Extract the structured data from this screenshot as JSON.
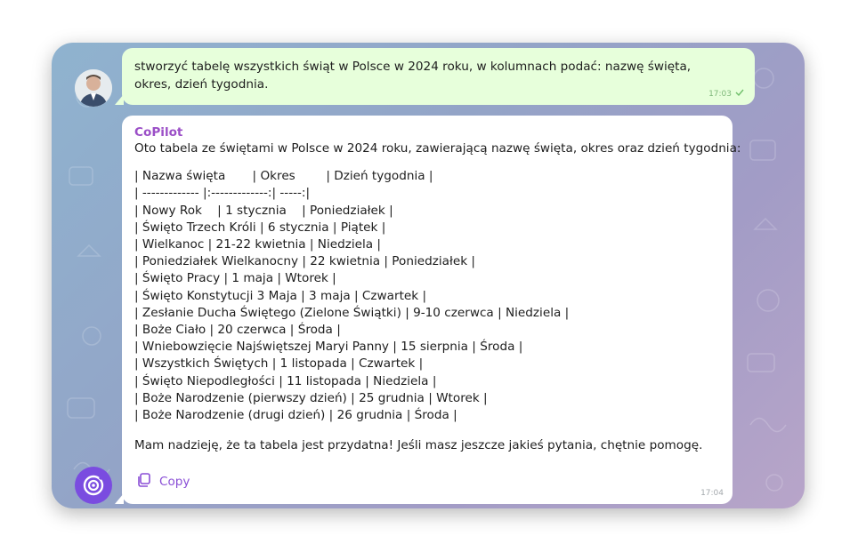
{
  "outgoing": {
    "text": "stworzyć tabelę wszystkich świąt w Polsce w 2024 roku, w kolumnach podać: nazwę święta, okres, dzień tygodnia.",
    "time": "17:03"
  },
  "incoming": {
    "sender": "CoPilot",
    "intro": "Oto tabela ze świętami w Polsce w 2024 roku, zawierającą nazwę święta, okres oraz dzień tygodnia:",
    "table_lines": [
      "| Nazwa święta       | Okres        | Dzień tygodnia |",
      "| ------------- |:-------------:| -----:|",
      "| Nowy Rok    | 1 stycznia    | Poniedziałek |",
      "| Święto Trzech Króli | 6 stycznia | Piątek |",
      "| Wielkanoc | 21-22 kwietnia | Niedziela |",
      "| Poniedziałek Wielkanocny | 22 kwietnia | Poniedziałek |",
      "| Święto Pracy | 1 maja | Wtorek |",
      "| Święto Konstytucji 3 Maja | 3 maja | Czwartek |",
      "| Zesłanie Ducha Świętego (Zielone Świątki) | 9-10 czerwca | Niedziela |",
      "| Boże Ciało | 20 czerwca | Środa |",
      "| Wniebowzięcie Najświętszej Maryi Panny | 15 sierpnia | Środa |",
      "| Wszystkich Świętych | 1 listopada | Czwartek |",
      "| Święto Niepodległości | 11 listopada | Niedziela |",
      "| Boże Narodzenie (pierwszy dzień) | 25 grudnia | Wtorek |",
      "| Boże Narodzenie (drugi dzień) | 26 grudnia | Środa |"
    ],
    "closing": "Mam nadzieję, że ta tabela jest przydatna! Jeśli masz jeszcze jakieś pytania, chętnie pomogę.",
    "copy_label": "Copy",
    "time": "17:04"
  },
  "colors": {
    "outgoing_bubble": "#e7ffdb",
    "incoming_bubble": "#ffffff",
    "sender_name": "#9b4fc7",
    "accent": "#7a4ce0"
  },
  "icons": {
    "check": "check-icon",
    "copy": "copy-icon",
    "bot": "copilot-logo-icon",
    "user": "user-avatar"
  }
}
